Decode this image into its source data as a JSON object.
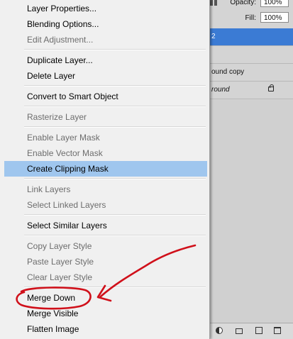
{
  "layers_panel": {
    "opacity_label": "Opacity:",
    "opacity_value": "100%",
    "fill_label": "Fill:",
    "fill_value": "100%",
    "layers": [
      {
        "name": "2",
        "selected": true
      },
      {
        "name": "",
        "selected": false
      },
      {
        "name": "ound copy",
        "selected": false
      },
      {
        "name": "round",
        "selected": false,
        "locked": true
      }
    ],
    "footer_icons": [
      "adjustment-layer-icon",
      "group-folder-icon",
      "new-layer-icon",
      "trash-icon"
    ]
  },
  "context_menu": {
    "items": [
      {
        "label": "Layer Properties...",
        "enabled": true
      },
      {
        "label": "Blending Options...",
        "enabled": true
      },
      {
        "label": "Edit Adjustment...",
        "enabled": false
      },
      {
        "label": "Duplicate Layer...",
        "enabled": true
      },
      {
        "label": "Delete Layer",
        "enabled": true
      },
      {
        "label": "Convert to Smart Object",
        "enabled": true
      },
      {
        "label": "Rasterize Layer",
        "enabled": false
      },
      {
        "label": "Enable Layer Mask",
        "enabled": false
      },
      {
        "label": "Enable Vector Mask",
        "enabled": false
      },
      {
        "label": "Create Clipping Mask",
        "enabled": true,
        "highlighted": true
      },
      {
        "label": "Link Layers",
        "enabled": false
      },
      {
        "label": "Select Linked Layers",
        "enabled": false
      },
      {
        "label": "Select Similar Layers",
        "enabled": true
      },
      {
        "label": "Copy Layer Style",
        "enabled": false
      },
      {
        "label": "Paste Layer Style",
        "enabled": false
      },
      {
        "label": "Clear Layer Style",
        "enabled": false
      },
      {
        "label": "Merge Down",
        "enabled": true,
        "annotated": true
      },
      {
        "label": "Merge Visible",
        "enabled": true
      },
      {
        "label": "Flatten Image",
        "enabled": true
      }
    ],
    "highlight_color": "#9fc6ee"
  },
  "annotation": {
    "color": "#d0101a",
    "marks": [
      "circle-around-merge-down",
      "arrow-pointing-to-merge-down"
    ]
  }
}
